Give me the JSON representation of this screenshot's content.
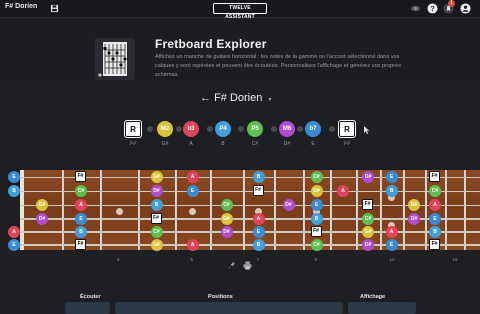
{
  "window": {
    "title": "F# Dorien"
  },
  "brand": {
    "name": "TWELVE ASSISTANT",
    "tagline": ""
  },
  "notifications": {
    "count": "1"
  },
  "hero": {
    "title": "Fretboard  Explorer",
    "description": "Affichez un manche de guitare horizontal : les notes de la gamme ou l'accord sélectionné dans vos calques y sont repérées et peuvent être écoutées. Personnalisez l'affichage et générez vos propres schémas."
  },
  "scale": {
    "selected": "F# Dorien"
  },
  "intervals": [
    {
      "label": "R",
      "note": "F#",
      "color": "#ffffff",
      "root": true
    },
    {
      "label": "M2",
      "note": "G#",
      "color": "#d9c43a"
    },
    {
      "label": "b3",
      "note": "A",
      "color": "#e0445a"
    },
    {
      "label": "P4",
      "note": "B",
      "color": "#3fa0dd"
    },
    {
      "label": "P5",
      "note": "C#",
      "color": "#5dbf4f"
    },
    {
      "label": "M6",
      "note": "D#",
      "color": "#b14bd1"
    },
    {
      "label": "b7",
      "note": "E",
      "color": "#3a8bd6"
    },
    {
      "label": "R",
      "note": "F#",
      "color": "#ffffff",
      "root": true
    }
  ],
  "strings_open": [
    "E",
    "B",
    "",
    "",
    "A",
    "E"
  ],
  "fret_numbers": [
    "3",
    "5",
    "7",
    "9",
    "12",
    "15"
  ],
  "panels": {
    "listen": "Écouter",
    "positions": "Positions",
    "display": "Affichage"
  },
  "colors": {
    "accent": "#3a8bd6",
    "background": "#1e1f23",
    "wood": "#7a3c19"
  },
  "icons": [
    "save-icon",
    "eye-icon",
    "help-icon",
    "bell-icon",
    "user-icon",
    "pin-icon",
    "print-icon",
    "cursor-icon"
  ]
}
